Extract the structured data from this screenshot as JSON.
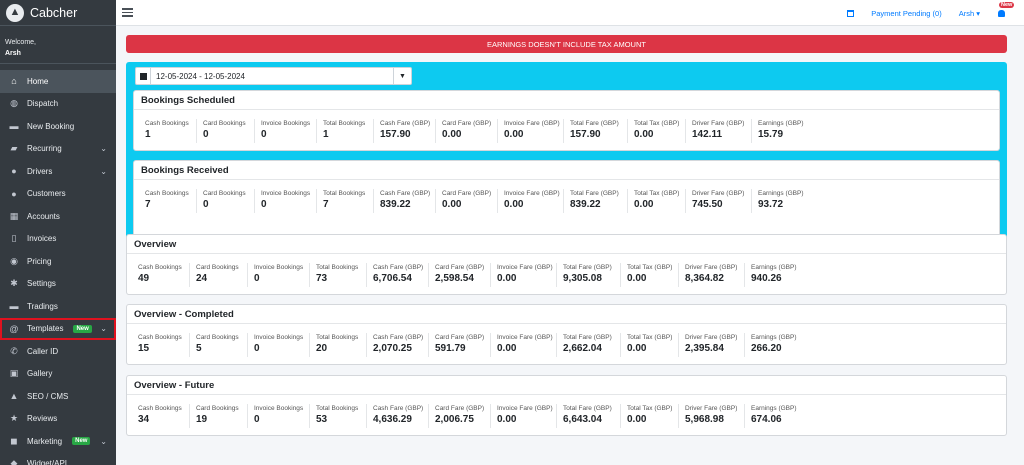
{
  "brand": {
    "name": "Cabcher"
  },
  "welcome": {
    "label": "Welcome,",
    "user": "Arsh"
  },
  "sidebar": {
    "items": [
      {
        "label": "Home",
        "icon": "home-icon",
        "glyph": "⌂",
        "active": true
      },
      {
        "label": "Dispatch",
        "icon": "globe-icon",
        "glyph": "◍"
      },
      {
        "label": "New Booking",
        "icon": "keyboard-icon",
        "glyph": "▬"
      },
      {
        "label": "Recurring",
        "icon": "car-icon",
        "glyph": "▰",
        "chevron": true
      },
      {
        "label": "Drivers",
        "icon": "users-icon",
        "glyph": "●",
        "chevron": true
      },
      {
        "label": "Customers",
        "icon": "users-icon",
        "glyph": "●"
      },
      {
        "label": "Accounts",
        "icon": "building-icon",
        "glyph": "▦"
      },
      {
        "label": "Invoices",
        "icon": "file-icon",
        "glyph": "▯"
      },
      {
        "label": "Pricing",
        "icon": "coins-icon",
        "glyph": "◉"
      },
      {
        "label": "Settings",
        "icon": "gear-icon",
        "glyph": "✱"
      },
      {
        "label": "Tradings",
        "icon": "box-icon",
        "glyph": "▬"
      },
      {
        "label": "Templates",
        "icon": "at-icon",
        "glyph": "@",
        "badge": "New",
        "chevron": true,
        "highlight": true
      },
      {
        "label": "Caller ID",
        "icon": "phone-icon",
        "glyph": "✆"
      },
      {
        "label": "Gallery",
        "icon": "images-icon",
        "glyph": "▣"
      },
      {
        "label": "SEO / CMS",
        "icon": "chart-icon",
        "glyph": "▲"
      },
      {
        "label": "Reviews",
        "icon": "star-icon",
        "glyph": "★"
      },
      {
        "label": "Marketing",
        "icon": "chat-icon",
        "glyph": "◼",
        "badge": "New",
        "chevron": true
      },
      {
        "label": "Widget/API",
        "icon": "layer-icon",
        "glyph": "◆"
      }
    ]
  },
  "topbar": {
    "payment_pending": "Payment Pending (0)",
    "user": "Arsh",
    "bell_badge": "New"
  },
  "alert": {
    "text": "EARNINGS DOESN'T INCLUDE TAX AMOUNT"
  },
  "date_range": {
    "value": "12-05-2024 - 12-05-2024"
  },
  "labels": [
    "Cash Bookings",
    "Card Bookings",
    "Invoice Bookings",
    "Total Bookings",
    "Cash Fare (GBP)",
    "Card Fare (GBP)",
    "Invoice Fare (GBP)",
    "Total Fare (GBP)",
    "Total Tax (GBP)",
    "Driver Fare (GBP)",
    "Earnings (GBP)"
  ],
  "cards": {
    "scheduled": {
      "title": "Bookings Scheduled",
      "values": [
        "1",
        "0",
        "0",
        "1",
        "157.90",
        "0.00",
        "0.00",
        "157.90",
        "0.00",
        "142.11",
        "15.79"
      ]
    },
    "received": {
      "title": "Bookings Received",
      "values": [
        "7",
        "0",
        "0",
        "7",
        "839.22",
        "0.00",
        "0.00",
        "839.22",
        "0.00",
        "745.50",
        "93.72"
      ]
    },
    "overview": {
      "title": "Overview",
      "values": [
        "49",
        "24",
        "0",
        "73",
        "6,706.54",
        "2,598.54",
        "0.00",
        "9,305.08",
        "0.00",
        "8,364.82",
        "940.26"
      ]
    },
    "completed": {
      "title": "Overview - Completed",
      "values": [
        "15",
        "5",
        "0",
        "20",
        "2,070.25",
        "591.79",
        "0.00",
        "2,662.04",
        "0.00",
        "2,395.84",
        "266.20"
      ]
    },
    "future": {
      "title": "Overview - Future",
      "values": [
        "34",
        "19",
        "0",
        "53",
        "4,636.29",
        "2,006.75",
        "0.00",
        "6,643.04",
        "0.00",
        "5,968.98",
        "674.06"
      ]
    }
  }
}
